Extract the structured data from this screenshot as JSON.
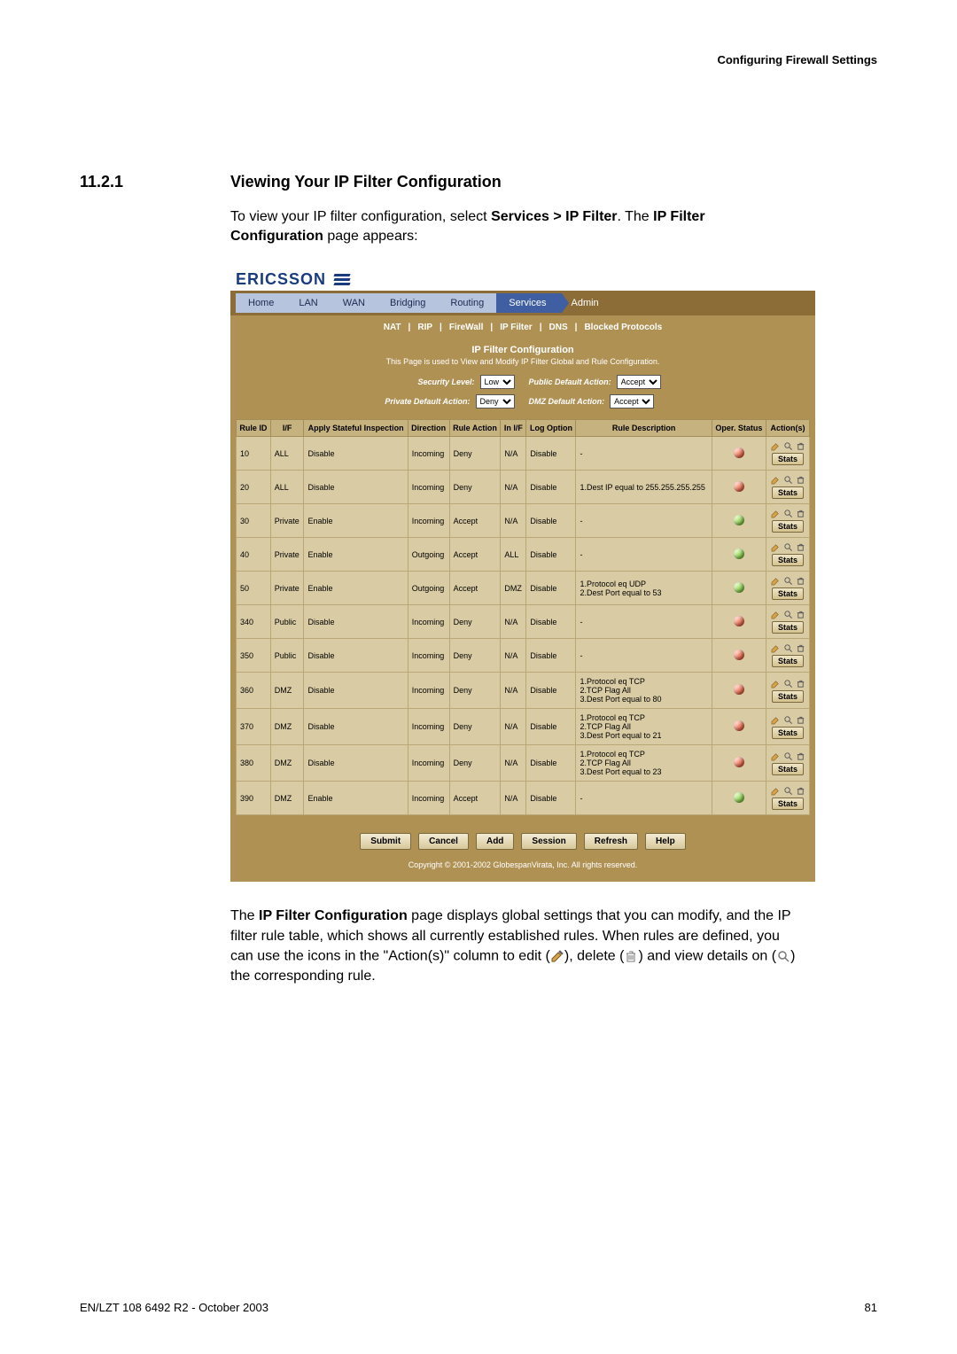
{
  "page_header": "Configuring Firewall Settings",
  "section_number": "11.2.1",
  "section_title": "Viewing Your IP Filter Configuration",
  "intro_1a": "To view your IP filter configuration, select ",
  "intro_1b": "Services > IP Filter",
  "intro_1c": ". The ",
  "intro_1d": "IP Filter Configuration",
  "intro_1e": " page appears:",
  "brand": "ERICSSON",
  "nav": [
    "Home",
    "LAN",
    "WAN",
    "Bridging",
    "Routing",
    "Services",
    "Admin"
  ],
  "nav_active_index": 5,
  "subnav": [
    "NAT",
    "RIP",
    "FireWall",
    "IP Filter",
    "DNS",
    "Blocked Protocols"
  ],
  "panel_title": "IP Filter Configuration",
  "panel_hint": "This Page is used to View and Modify IP Filter Global and Rule Configuration.",
  "globals": {
    "security_level_label": "Security Level:",
    "security_level_value": "Low",
    "public_default_action_label": "Public Default Action:",
    "public_default_action_value": "Accept",
    "private_default_action_label": "Private Default Action:",
    "private_default_action_value": "Deny",
    "dmz_default_action_label": "DMZ Default Action:",
    "dmz_default_action_value": "Accept"
  },
  "cols": [
    "Rule ID",
    "I/F",
    "Apply Stateful Inspection",
    "Direction",
    "Rule Action",
    "In I/F",
    "Log Option",
    "Rule Description",
    "Oper. Status",
    "Action(s)"
  ],
  "rows": [
    {
      "id": "10",
      "if": "ALL",
      "asi": "Disable",
      "dir": "Incoming",
      "ra": "Deny",
      "inif": "N/A",
      "log": "Disable",
      "desc": "-",
      "status": "red"
    },
    {
      "id": "20",
      "if": "ALL",
      "asi": "Disable",
      "dir": "Incoming",
      "ra": "Deny",
      "inif": "N/A",
      "log": "Disable",
      "desc": "1.Dest IP equal to 255.255.255.255",
      "status": "red"
    },
    {
      "id": "30",
      "if": "Private",
      "asi": "Enable",
      "dir": "Incoming",
      "ra": "Accept",
      "inif": "N/A",
      "log": "Disable",
      "desc": "-",
      "status": "green"
    },
    {
      "id": "40",
      "if": "Private",
      "asi": "Enable",
      "dir": "Outgoing",
      "ra": "Accept",
      "inif": "ALL",
      "log": "Disable",
      "desc": "-",
      "status": "green"
    },
    {
      "id": "50",
      "if": "Private",
      "asi": "Enable",
      "dir": "Outgoing",
      "ra": "Accept",
      "inif": "DMZ",
      "log": "Disable",
      "desc": "1.Protocol eq UDP\n2.Dest Port equal to 53",
      "status": "green"
    },
    {
      "id": "340",
      "if": "Public",
      "asi": "Disable",
      "dir": "Incoming",
      "ra": "Deny",
      "inif": "N/A",
      "log": "Disable",
      "desc": "-",
      "status": "red"
    },
    {
      "id": "350",
      "if": "Public",
      "asi": "Disable",
      "dir": "Incoming",
      "ra": "Deny",
      "inif": "N/A",
      "log": "Disable",
      "desc": "-",
      "status": "red"
    },
    {
      "id": "360",
      "if": "DMZ",
      "asi": "Disable",
      "dir": "Incoming",
      "ra": "Deny",
      "inif": "N/A",
      "log": "Disable",
      "desc": "1.Protocol eq TCP\n2.TCP Flag All\n3.Dest Port equal to 80",
      "status": "red"
    },
    {
      "id": "370",
      "if": "DMZ",
      "asi": "Disable",
      "dir": "Incoming",
      "ra": "Deny",
      "inif": "N/A",
      "log": "Disable",
      "desc": "1.Protocol eq TCP\n2.TCP Flag All\n3.Dest Port equal to 21",
      "status": "red"
    },
    {
      "id": "380",
      "if": "DMZ",
      "asi": "Disable",
      "dir": "Incoming",
      "ra": "Deny",
      "inif": "N/A",
      "log": "Disable",
      "desc": "1.Protocol eq TCP\n2.TCP Flag All\n3.Dest Port equal to 23",
      "status": "red"
    },
    {
      "id": "390",
      "if": "DMZ",
      "asi": "Enable",
      "dir": "Incoming",
      "ra": "Accept",
      "inif": "N/A",
      "log": "Disable",
      "desc": "-",
      "status": "green"
    }
  ],
  "buttons": [
    "Submit",
    "Cancel",
    "Add",
    "Session",
    "Refresh",
    "Help"
  ],
  "stats_label": "Stats",
  "copyright": "Copyright © 2001-2002 GlobespanVirata, Inc. All rights reserved.",
  "outro_1a": "The ",
  "outro_1b": "IP Filter Configuration",
  "outro_1c": " page displays global settings that you can modify, and the IP filter rule table, which shows all currently established rules. When rules are defined, you can use the icons in the \"Action(s)\" column to edit (",
  "outro_1d": "), delete (",
  "outro_1e": ") and view details on (",
  "outro_1f": ") the corresponding rule.",
  "footer_left": "EN/LZT 108 6492 R2 - October 2003",
  "footer_right": "81"
}
